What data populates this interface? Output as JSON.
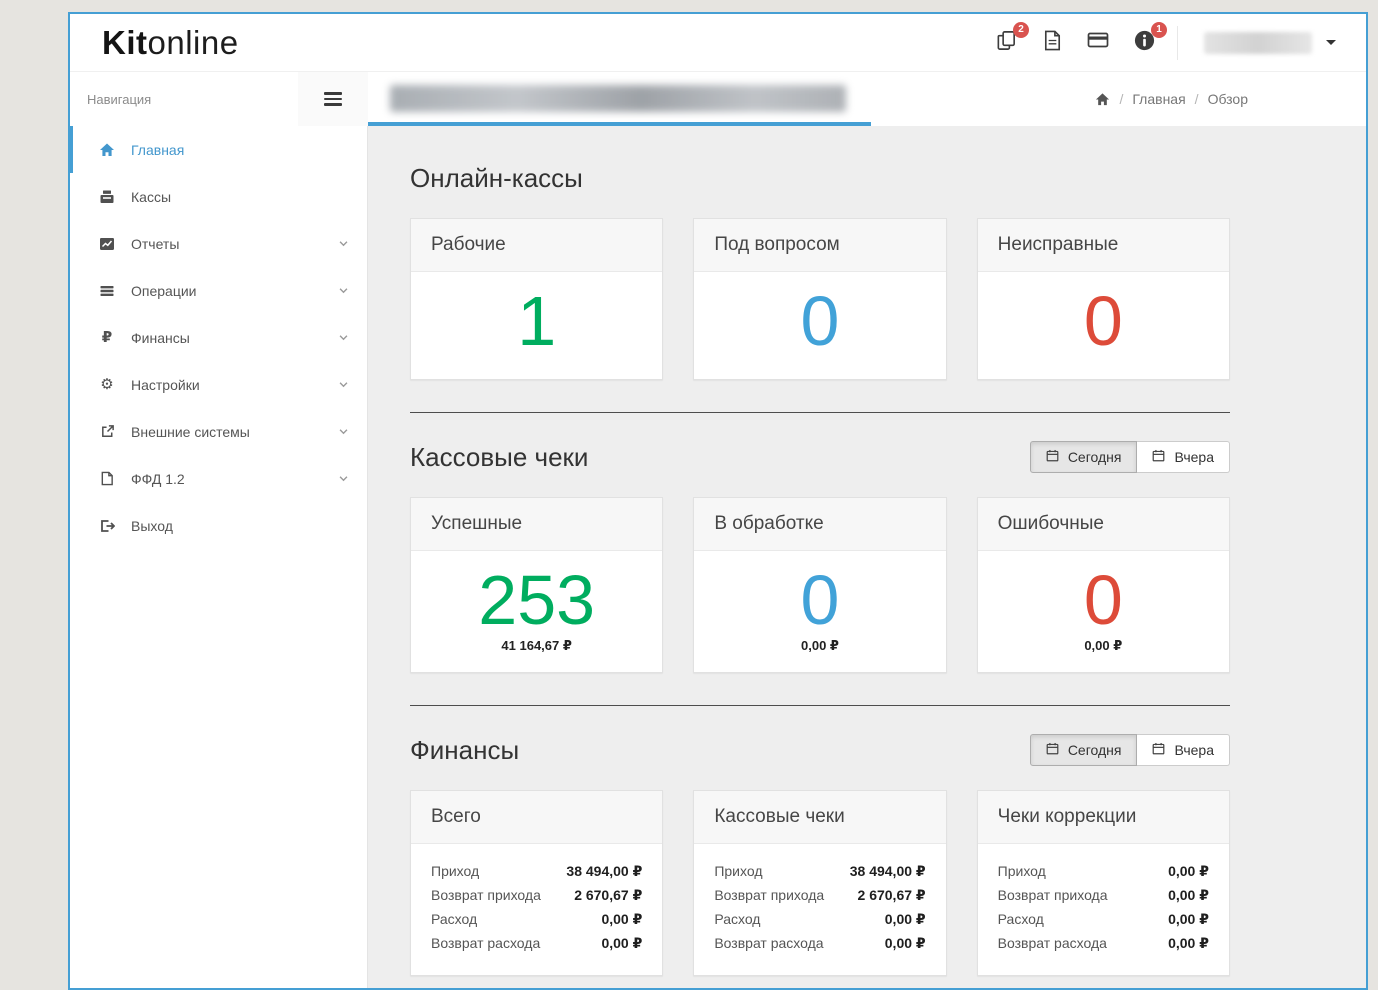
{
  "header": {
    "logo_bold": "Kit",
    "logo_light": "online",
    "icons": [
      {
        "name": "copy-documents",
        "badge": "2"
      },
      {
        "name": "pdf-file"
      },
      {
        "name": "credit-card"
      },
      {
        "name": "info",
        "badge": "1"
      }
    ]
  },
  "nav": {
    "title": "Навигация",
    "items": [
      {
        "label": "Главная",
        "icon": "home",
        "active": true
      },
      {
        "label": "Кассы",
        "icon": "cash-register"
      },
      {
        "label": "Отчеты",
        "icon": "line-chart",
        "expandable": true
      },
      {
        "label": "Операции",
        "icon": "list",
        "expandable": true
      },
      {
        "label": "Финансы",
        "icon": "ruble",
        "expandable": true
      },
      {
        "label": "Настройки",
        "icon": "gears",
        "expandable": true
      },
      {
        "label": "Внешние системы",
        "icon": "external-link",
        "expandable": true
      },
      {
        "label": "ФФД 1.2",
        "icon": "file",
        "expandable": true
      },
      {
        "label": "Выход",
        "icon": "logout"
      }
    ]
  },
  "breadcrumb": {
    "items": [
      "Главная",
      "Обзор"
    ]
  },
  "filters": {
    "today": "Сегодня",
    "yesterday": "Вчера"
  },
  "sections": {
    "cashboxes": {
      "title": "Онлайн-кассы",
      "cards": [
        {
          "label": "Рабочие",
          "value": "1",
          "color": "green"
        },
        {
          "label": "Под вопросом",
          "value": "0",
          "color": "blue"
        },
        {
          "label": "Неисправные",
          "value": "0",
          "color": "red"
        }
      ]
    },
    "receipts": {
      "title": "Кассовые чеки",
      "cards": [
        {
          "label": "Успешные",
          "value": "253",
          "amount": "41 164,67 ₽",
          "color": "green"
        },
        {
          "label": "В обработке",
          "value": "0",
          "amount": "0,00 ₽",
          "color": "blue"
        },
        {
          "label": "Ошибочные",
          "value": "0",
          "amount": "0,00 ₽",
          "color": "red"
        }
      ]
    },
    "finance": {
      "title": "Финансы",
      "row_labels": [
        "Приход",
        "Возврат прихода",
        "Расход",
        "Возврат расхода"
      ],
      "cards": [
        {
          "label": "Всего",
          "values": [
            "38 494,00 ₽",
            "2 670,67 ₽",
            "0,00 ₽",
            "0,00 ₽"
          ]
        },
        {
          "label": "Кассовые чеки",
          "values": [
            "38 494,00 ₽",
            "2 670,67 ₽",
            "0,00 ₽",
            "0,00 ₽"
          ]
        },
        {
          "label": "Чеки коррекции",
          "values": [
            "0,00 ₽",
            "0,00 ₽",
            "0,00 ₽",
            "0,00 ₽"
          ]
        }
      ]
    }
  },
  "colors": {
    "accent": "#459fd4",
    "green": "#00ad5f",
    "blue": "#41a2d8",
    "red": "#dd4b39",
    "badge": "#d9534f"
  }
}
